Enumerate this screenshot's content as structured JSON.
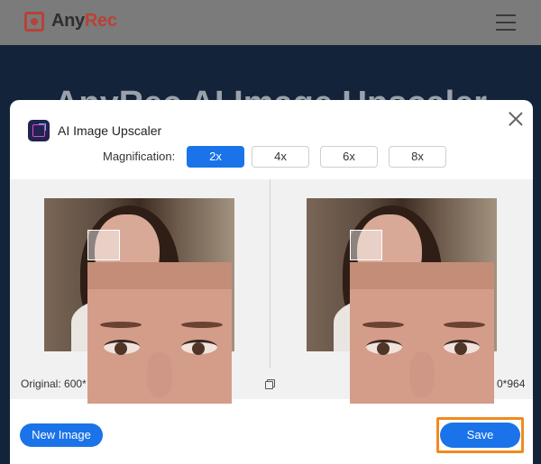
{
  "site": {
    "brand_prefix": "Any",
    "brand_suffix": "Rec",
    "hero_title": "AnyRec AI Image Upscaler"
  },
  "modal": {
    "title": "AI Image Upscaler",
    "magnification_label": "Magnification:",
    "options": [
      "2x",
      "4x",
      "6x",
      "8x"
    ],
    "selected_option": "2x",
    "original_info": "Original: 600*",
    "output_info": "0*964",
    "new_image_label": "New Image",
    "save_label": "Save"
  },
  "colors": {
    "accent": "#1a73e8",
    "highlight": "#f08a1c",
    "brand": "#b84237"
  }
}
